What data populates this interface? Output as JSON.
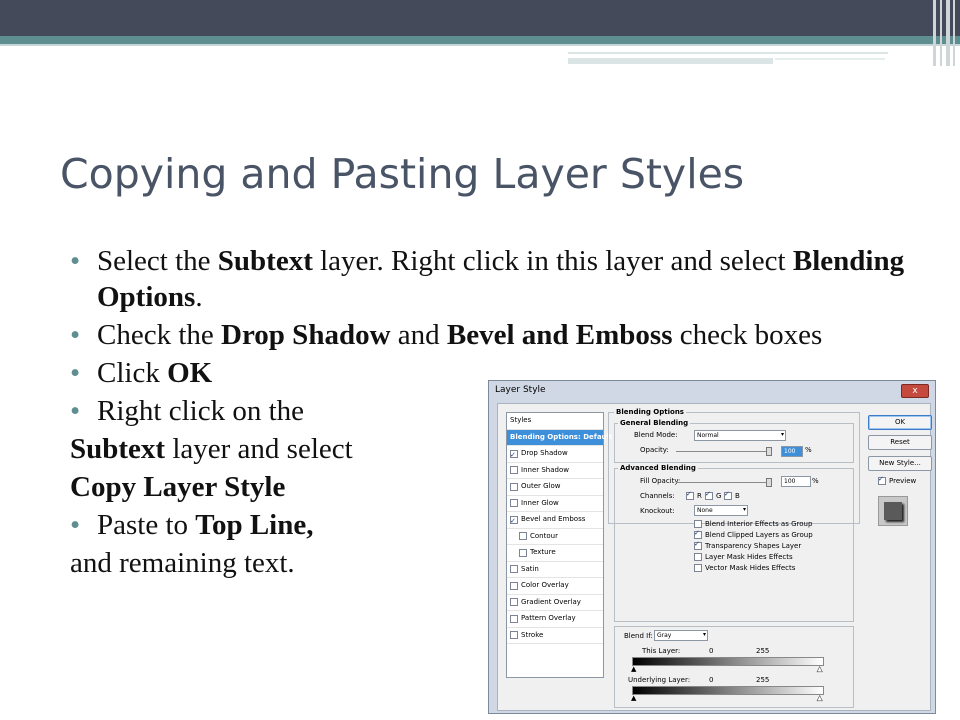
{
  "slide": {
    "title": "Copying and Pasting Layer Styles",
    "b1": {
      "t1": "Select the ",
      "t2": "Subtext",
      "t3": " layer. Right click in this layer and select ",
      "t4": "Blending Options",
      "t5": "."
    },
    "b2": {
      "t1": "Check the ",
      "t2": "Drop Shadow",
      "t3": " and ",
      "t4": "Bevel and Emboss",
      "t5": " check boxes"
    },
    "b3": {
      "t1": "Click ",
      "t2": "OK"
    },
    "b4": {
      "t1": "Right click on the"
    },
    "p1": {
      "t1": "Subtext",
      "t2": " layer and select"
    },
    "p2": {
      "t1": "Copy Layer Style"
    },
    "b5": {
      "t1": "Paste to ",
      "t2": "Top Line,"
    },
    "p3": {
      "t1": "and remaining text."
    }
  },
  "dialog": {
    "title": "Layer Style",
    "close": "x",
    "styles_header": "Styles",
    "styles": [
      {
        "label": "Blending Options: Default",
        "checkbox": false,
        "checked": false,
        "selected": true,
        "indent": false
      },
      {
        "label": "Drop Shadow",
        "checkbox": true,
        "checked": true,
        "selected": false,
        "indent": false
      },
      {
        "label": "Inner Shadow",
        "checkbox": true,
        "checked": false,
        "selected": false,
        "indent": false
      },
      {
        "label": "Outer Glow",
        "checkbox": true,
        "checked": false,
        "selected": false,
        "indent": false
      },
      {
        "label": "Inner Glow",
        "checkbox": true,
        "checked": false,
        "selected": false,
        "indent": false
      },
      {
        "label": "Bevel and Emboss",
        "checkbox": true,
        "checked": true,
        "selected": false,
        "indent": false
      },
      {
        "label": "Contour",
        "checkbox": true,
        "checked": false,
        "selected": false,
        "indent": true
      },
      {
        "label": "Texture",
        "checkbox": true,
        "checked": false,
        "selected": false,
        "indent": true
      },
      {
        "label": "Satin",
        "checkbox": true,
        "checked": false,
        "selected": false,
        "indent": false
      },
      {
        "label": "Color Overlay",
        "checkbox": true,
        "checked": false,
        "selected": false,
        "indent": false
      },
      {
        "label": "Gradient Overlay",
        "checkbox": true,
        "checked": false,
        "selected": false,
        "indent": false
      },
      {
        "label": "Pattern Overlay",
        "checkbox": true,
        "checked": false,
        "selected": false,
        "indent": false
      },
      {
        "label": "Stroke",
        "checkbox": true,
        "checked": false,
        "selected": false,
        "indent": false
      }
    ],
    "blending_options": "Blending Options",
    "general_blending": "General Blending",
    "blend_mode_label": "Blend Mode:",
    "blend_mode_value": "Normal",
    "opacity_label": "Opacity:",
    "opacity_value": "100",
    "percent": "%",
    "advanced_blending": "Advanced Blending",
    "fill_opacity_label": "Fill Opacity:",
    "fill_opacity_value": "100",
    "channels_label": "Channels:",
    "channels": [
      "R",
      "G",
      "B"
    ],
    "knockout_label": "Knockout:",
    "knockout_value": "None",
    "advanced_checks": [
      {
        "label": "Blend Interior Effects as Group",
        "checked": false
      },
      {
        "label": "Blend Clipped Layers as Group",
        "checked": true
      },
      {
        "label": "Transparency Shapes Layer",
        "checked": true
      },
      {
        "label": "Layer Mask Hides Effects",
        "checked": false
      },
      {
        "label": "Vector Mask Hides Effects",
        "checked": false
      }
    ],
    "blend_if_label": "Blend If:",
    "blend_if_value": "Gray",
    "this_layer_label": "This Layer:",
    "this_layer_min": "0",
    "this_layer_max": "255",
    "underlying_label": "Underlying Layer:",
    "underlying_min": "0",
    "underlying_max": "255",
    "buttons": {
      "ok": "OK",
      "reset": "Reset",
      "new_style": "New Style..."
    },
    "preview_label": "Preview",
    "preview_checked": true
  }
}
